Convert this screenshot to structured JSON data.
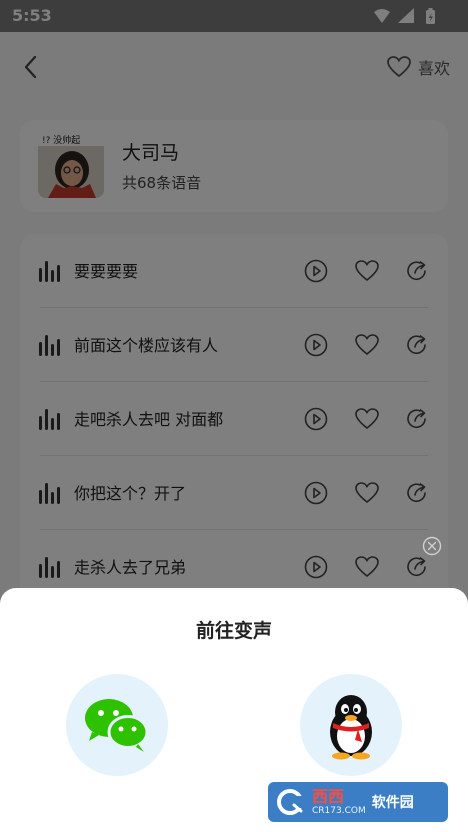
{
  "status_bar": {
    "time": "5:53"
  },
  "header": {
    "like_label": "喜欢"
  },
  "author": {
    "avatar_caption": "!? 没帅起",
    "name": "大司马",
    "count": "共68条语音"
  },
  "clips": [
    {
      "title": "要要要要"
    },
    {
      "title": "前面这个楼应该有人"
    },
    {
      "title": "走吧杀人去吧 对面都"
    },
    {
      "title": "你把这个？开了"
    },
    {
      "title": "走杀人去了兄弟"
    }
  ],
  "sheet": {
    "title": "前往变声",
    "options": [
      {
        "icon": "wechat-icon",
        "color": "#2dc100"
      },
      {
        "icon": "qq-penguin-icon",
        "color": "#000000"
      }
    ]
  },
  "watermark": {
    "main": "西西",
    "side": "软件园",
    "sub": "CR173.COM"
  }
}
